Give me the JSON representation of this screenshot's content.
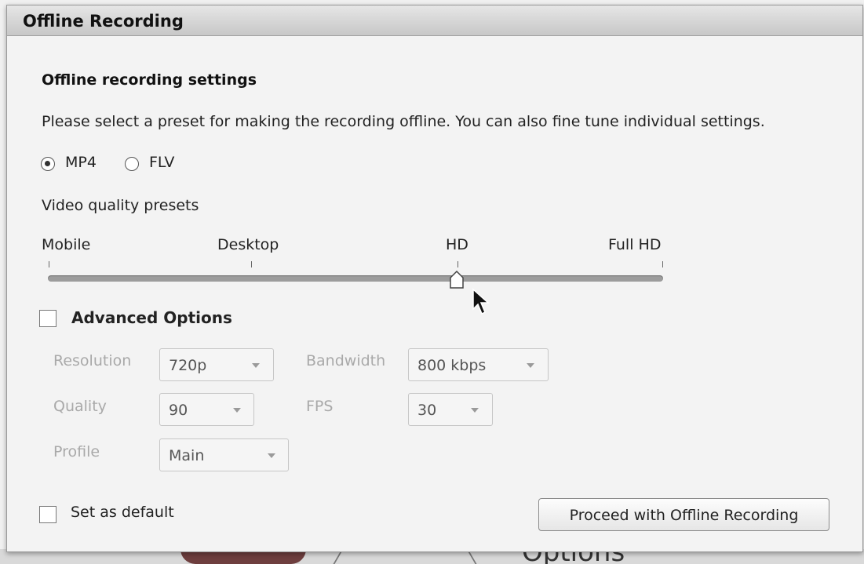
{
  "dialog": {
    "title": "Offline Recording",
    "heading": "Offline recording settings",
    "description": "Please select a preset for making the recording offline. You can also fine tune individual settings."
  },
  "format": {
    "options": [
      {
        "label": "MP4",
        "checked": true
      },
      {
        "label": "FLV",
        "checked": false
      }
    ]
  },
  "presets": {
    "label": "Video quality presets",
    "ticks": [
      "Mobile",
      "Desktop",
      "HD",
      "Full HD"
    ],
    "selected": "HD"
  },
  "advanced": {
    "label": "Advanced Options",
    "checked": false,
    "resolution_label": "Resolution",
    "resolution_value": "720p",
    "bandwidth_label": "Bandwidth",
    "bandwidth_value": "800 kbps",
    "quality_label": "Quality",
    "quality_value": "90",
    "fps_label": "FPS",
    "fps_value": "30",
    "profile_label": "Profile",
    "profile_value": "Main"
  },
  "footer": {
    "default_label": "Set as default",
    "default_checked": false,
    "proceed_label": "Proceed with Offline Recording"
  },
  "background": {
    "partial_text": "Options"
  },
  "colors": {
    "disabled_text": "#a9a9a9",
    "track": "#9c9c9c"
  },
  "icons": {
    "cursor": "mouse-pointer-icon",
    "dropdown": "chevron-down-icon"
  }
}
